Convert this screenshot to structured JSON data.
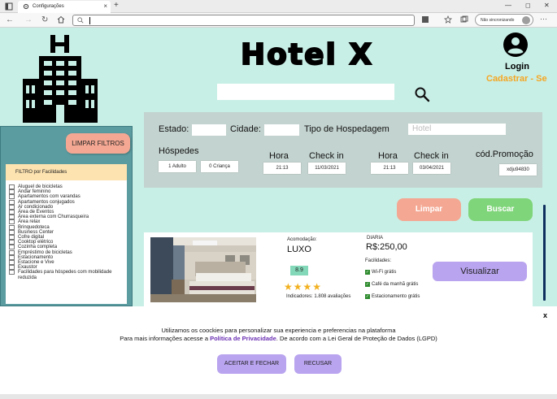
{
  "browser": {
    "tab_title": "Configurações",
    "tab_close": "×",
    "new_tab": "+",
    "sync_label": "Não sincronizando",
    "more": "···",
    "win_min": "—",
    "win_max": "◻",
    "win_close": "✕"
  },
  "header": {
    "title": "Hotel X",
    "login": "Login",
    "signup": "Cadastrar - Se",
    "search_value": ""
  },
  "sidebar": {
    "clear_button": "LIMPAR FILTROS",
    "filter_header": "FILTRO por Facilidades",
    "items": [
      "Aluguel de bicicletas",
      "Andar feminino",
      "Apartamentos com varandas",
      "Apartamentos conjugados",
      "Ar condicionado",
      "Área de Eventos",
      "Área externa com Churrasqueira",
      "Área relax",
      "Brinquedoteca",
      "Business Center",
      "Cofre digital",
      "Cooktop elétrico",
      "Cozinha completa",
      "Empréstimo de bicicletas",
      "Estacionamento",
      "Estacione e Vive",
      "Exaustor",
      "Facilidades para hóspedes com mobilidade",
      "reduzida"
    ]
  },
  "filters": {
    "estado_label": "Estado:",
    "cidade_label": "Cidade:",
    "tipo_label": "Tipo de Hospedagem",
    "tipo_placeholder": "Hotel",
    "hospedes_label": "Hóspedes",
    "adultos": "1 Adulto",
    "criancas": "0 Criança",
    "hora_label_1": "Hora",
    "hora_1": "21:13",
    "checkin_label": "Check in",
    "checkin_date": "11/03/2021",
    "hora_label_2": "Hora",
    "hora_2": "21:13",
    "checkin_label_2": "Check in",
    "checkin_date_2": "03/04/2021",
    "promo_label": "cód.Promoção",
    "promo_code": "xdju94830",
    "clear_button": "Limpar",
    "search_button": "Buscar"
  },
  "result": {
    "acomodacao_label": "Acomodação:",
    "acomodacao": "LUXO",
    "score": "8.9",
    "stars": 4,
    "stars_text": "★★★★",
    "indicators": "Indicadores: 1.808 avaliações",
    "diaria_label": "DIARIA",
    "price": "R$:250,00",
    "facilities_label": "Facilidades:",
    "facilities": [
      "Wi-Fi grátis",
      "Café da manhã grátis",
      "Estacionamento grátis"
    ],
    "view_button": "Visualizar"
  },
  "cookie": {
    "line1": "Utilizamos os coockies para personalizar sua experiencia  e preferencias na plataforma",
    "line2_before": "Para mais informações acesse a ",
    "line2_link": "Política de Privacidade",
    "line2_after": ". De acordo com a Lei Geral de Proteção de Dados (LGPD)",
    "accept_button": "ACEITAR E FECHAR",
    "reject_button": "RECUSAR",
    "close": "x"
  },
  "colors": {
    "page_bg": "#c8efe6",
    "sidebar_bg": "#5b9ca0",
    "filter_panel_bg": "#c3d3cf",
    "limpar": "#f4a893",
    "buscar": "#7fd57a",
    "visualizar": "#b9a4ef",
    "signup": "#f5a623",
    "link": "#6a2fb3"
  }
}
